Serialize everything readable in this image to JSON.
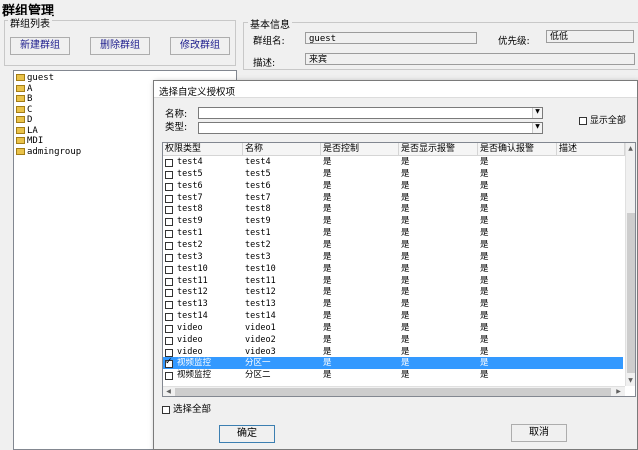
{
  "page": {
    "title": "群组管理"
  },
  "group_list": {
    "label": "群组列表",
    "buttons": {
      "new": "新建群组",
      "delete": "删除群组",
      "modify": "修改群组"
    },
    "items": [
      "guest",
      "A",
      "B",
      "C",
      "D",
      "LA",
      "MDI",
      "admingroup"
    ]
  },
  "basic_info": {
    "label": "基本信息",
    "name_label": "群组名:",
    "name_value": "guest",
    "priority_label": "优先级:",
    "priority_value": "低低",
    "desc_label": "描述:",
    "desc_value": "来宾"
  },
  "dialog": {
    "title": "选择自定义授权项",
    "name_label": "名称:",
    "type_label": "类型:",
    "show_all": "显示全部",
    "columns": [
      "权限类型",
      "名称",
      "是否控制",
      "是否显示报警",
      "是否确认报警",
      "描述"
    ],
    "rows": [
      {
        "type": "test4",
        "name": "test4",
        "control": "是",
        "show_alarm": "是",
        "confirm_alarm": "是",
        "checked": false
      },
      {
        "type": "test5",
        "name": "test5",
        "control": "是",
        "show_alarm": "是",
        "confirm_alarm": "是",
        "checked": false
      },
      {
        "type": "test6",
        "name": "test6",
        "control": "是",
        "show_alarm": "是",
        "confirm_alarm": "是",
        "checked": false
      },
      {
        "type": "test7",
        "name": "test7",
        "control": "是",
        "show_alarm": "是",
        "confirm_alarm": "是",
        "checked": false
      },
      {
        "type": "test8",
        "name": "test8",
        "control": "是",
        "show_alarm": "是",
        "confirm_alarm": "是",
        "checked": false
      },
      {
        "type": "test9",
        "name": "test9",
        "control": "是",
        "show_alarm": "是",
        "confirm_alarm": "是",
        "checked": false
      },
      {
        "type": "test1",
        "name": "test1",
        "control": "是",
        "show_alarm": "是",
        "confirm_alarm": "是",
        "checked": false
      },
      {
        "type": "test2",
        "name": "test2",
        "control": "是",
        "show_alarm": "是",
        "confirm_alarm": "是",
        "checked": false
      },
      {
        "type": "test3",
        "name": "test3",
        "control": "是",
        "show_alarm": "是",
        "confirm_alarm": "是",
        "checked": false
      },
      {
        "type": "test10",
        "name": "test10",
        "control": "是",
        "show_alarm": "是",
        "confirm_alarm": "是",
        "checked": false
      },
      {
        "type": "test11",
        "name": "test11",
        "control": "是",
        "show_alarm": "是",
        "confirm_alarm": "是",
        "checked": false
      },
      {
        "type": "test12",
        "name": "test12",
        "control": "是",
        "show_alarm": "是",
        "confirm_alarm": "是",
        "checked": false
      },
      {
        "type": "test13",
        "name": "test13",
        "control": "是",
        "show_alarm": "是",
        "confirm_alarm": "是",
        "checked": false
      },
      {
        "type": "test14",
        "name": "test14",
        "control": "是",
        "show_alarm": "是",
        "confirm_alarm": "是",
        "checked": false
      },
      {
        "type": "video",
        "name": "video1",
        "control": "是",
        "show_alarm": "是",
        "confirm_alarm": "是",
        "checked": false
      },
      {
        "type": "video",
        "name": "video2",
        "control": "是",
        "show_alarm": "是",
        "confirm_alarm": "是",
        "checked": false
      },
      {
        "type": "video",
        "name": "video3",
        "control": "是",
        "show_alarm": "是",
        "confirm_alarm": "是",
        "checked": false
      },
      {
        "type": "视频监控",
        "name": "分区一",
        "control": "是",
        "show_alarm": "是",
        "confirm_alarm": "是",
        "checked": true,
        "selected": true
      },
      {
        "type": "视频监控",
        "name": "分区二",
        "control": "是",
        "show_alarm": "是",
        "confirm_alarm": "是",
        "checked": false
      }
    ],
    "select_all": "选择全部",
    "ok": "确定",
    "cancel": "取消"
  },
  "colors": {
    "selection": "#3399ff",
    "folder": "#e9c24a",
    "button_text": "#1a1a8c"
  }
}
